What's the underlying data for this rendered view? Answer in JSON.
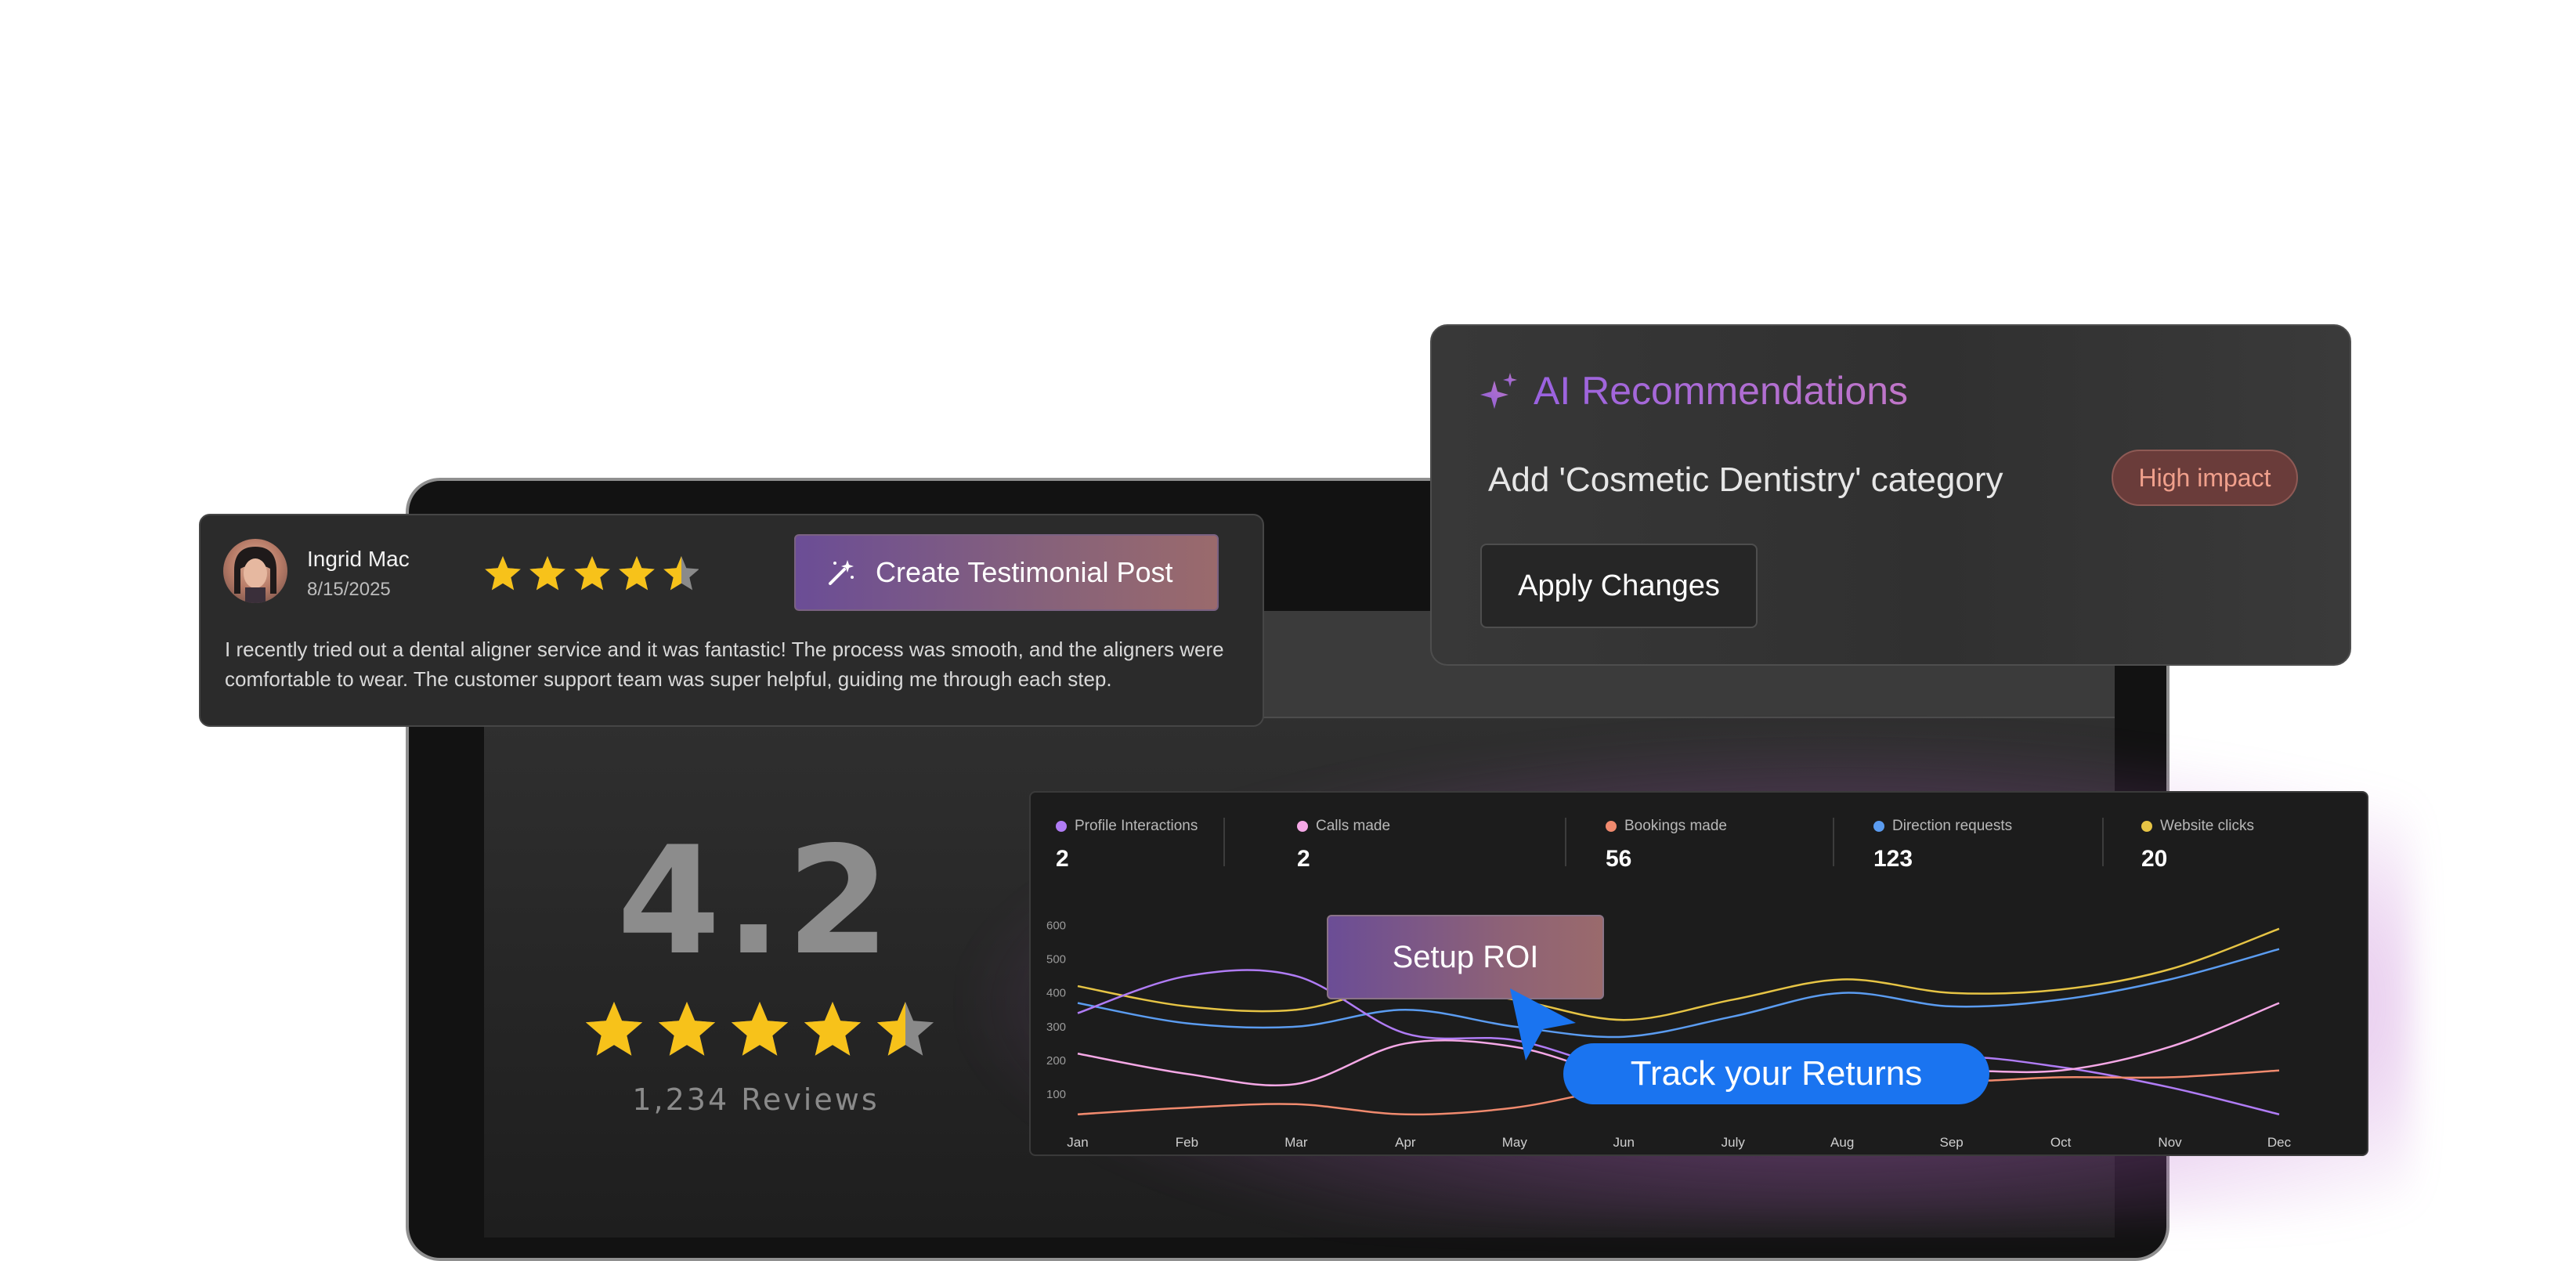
{
  "review": {
    "name": "Ingrid Mac",
    "date": "8/15/2025",
    "rating": 4.5,
    "text": "I recently tried out a dental aligner service and it was fantastic! The process was smooth, and the aligners were comfortable to wear. The customer support team was super helpful, guiding me through each step.",
    "create_button_label": "Create Testimonial Post"
  },
  "summary": {
    "rating_value": "4.2",
    "stars": 4.5,
    "reviews_label": "1,234 Reviews"
  },
  "ai": {
    "title": "AI Recommendations",
    "recommendation": "Add 'Cosmetic Dentistry' category",
    "badge": "High impact",
    "apply_label": "Apply Changes"
  },
  "metrics": [
    {
      "label": "Profile Interactions",
      "value": "2",
      "color": "#b07cf5"
    },
    {
      "label": "Calls made",
      "value": "2",
      "color": "#f5a8e6"
    },
    {
      "label": "Bookings made",
      "value": "56",
      "color": "#f08a6e"
    },
    {
      "label": "Direction requests",
      "value": "123",
      "color": "#5b9cf0"
    },
    {
      "label": "Website clicks",
      "value": "20",
      "color": "#e6c445"
    }
  ],
  "overlay_buttons": {
    "setup_roi": "Setup ROI",
    "track_returns": "Track your Returns"
  },
  "chart_data": {
    "type": "line",
    "categories": [
      "Jan",
      "Feb",
      "Mar",
      "Apr",
      "May",
      "Jun",
      "July",
      "Aug",
      "Sep",
      "Oct",
      "Nov",
      "Dec"
    ],
    "y_ticks": [
      100,
      200,
      300,
      400,
      500,
      600
    ],
    "ylim": [
      0,
      650
    ],
    "grid": false,
    "series": [
      {
        "name": "Website clicks",
        "color": "#e6c445",
        "values": [
          420,
          360,
          350,
          420,
          380,
          320,
          380,
          440,
          400,
          410,
          470,
          590
        ]
      },
      {
        "name": "Direction requests",
        "color": "#5b9cf0",
        "values": [
          370,
          310,
          300,
          350,
          300,
          270,
          330,
          400,
          360,
          380,
          440,
          530
        ]
      },
      {
        "name": "Profile Interactions",
        "color": "#b07cf5",
        "values": [
          340,
          450,
          450,
          280,
          260,
          170,
          140,
          160,
          210,
          180,
          120,
          40
        ]
      },
      {
        "name": "Calls made",
        "color": "#f5a8e6",
        "values": [
          220,
          160,
          130,
          250,
          240,
          150,
          120,
          160,
          170,
          170,
          240,
          370
        ]
      },
      {
        "name": "Bookings made",
        "color": "#f08a6e",
        "values": [
          40,
          60,
          70,
          40,
          60,
          120,
          150,
          180,
          140,
          150,
          150,
          170
        ]
      }
    ]
  }
}
